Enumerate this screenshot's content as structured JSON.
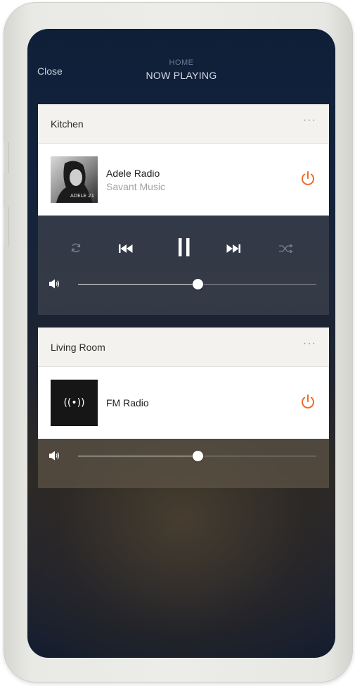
{
  "header": {
    "close_label": "Close",
    "subtitle": "HOME",
    "title": "NOW PLAYING"
  },
  "zones": [
    {
      "name": "Kitchen",
      "more_label": "···",
      "media_title": "Adele Radio",
      "media_source": "Savant Music",
      "album_art_text": "ADELE 21",
      "volume_level": 0.5,
      "transport": [
        "repeat-icon",
        "previous-icon",
        "pause-icon",
        "next-icon",
        "shuffle-icon"
      ]
    },
    {
      "name": "Living Room",
      "more_label": "···",
      "media_title": "FM Radio",
      "media_source": "",
      "radio_glyph": "((•))",
      "volume_level": 0.5
    }
  ],
  "colors": {
    "power_accent": "#f06a2b",
    "screen_top": "#0f1f38",
    "panel_light": "#f3f2ef"
  }
}
